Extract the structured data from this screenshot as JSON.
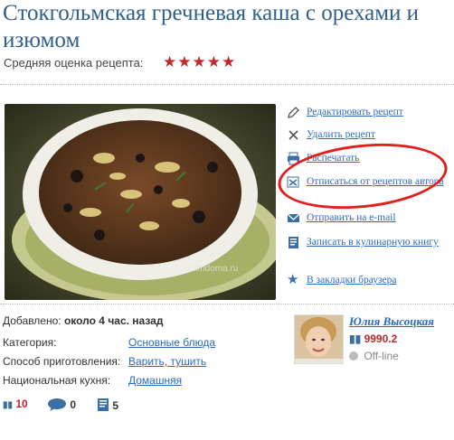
{
  "recipe": {
    "title": "Стокгольмская гречневая каша с орехами и изюмом",
    "rating_label": "Средняя оценка рецепта:",
    "stars": "★★★★★",
    "photo_watermark": "edimdoma.ru"
  },
  "actions": [
    {
      "label": "Редактировать рецепт",
      "icon": "pencil-icon"
    },
    {
      "label": "Удалить рецепт",
      "icon": "close-icon"
    },
    {
      "label": "Распечатать",
      "icon": "printer-icon"
    },
    {
      "label": "Отписаться от рецептов автора",
      "icon": "unsubscribe-icon"
    },
    {
      "label": "Отправить на e-mail",
      "icon": "envelope-icon"
    },
    {
      "label": "Записать в кулинарную книгу",
      "icon": "cookbook-icon"
    },
    {
      "label": "В закладки браузера",
      "icon": "star-icon"
    }
  ],
  "details": {
    "added_label": "Добавлено:",
    "added_value": "около 4 час. назад",
    "category_label": "Категория:",
    "category_value": "Основные блюда",
    "method_label": "Способ приготовления:",
    "method_value": "Варить, тушить",
    "cuisine_label": "Национальная кухня:",
    "cuisine_value": "Домашняя"
  },
  "author": {
    "name": "Юлия Высоцкая",
    "score": "9990.2",
    "status": "Off-line"
  },
  "stats": {
    "rating": "10",
    "comments": "0",
    "books": "5"
  },
  "colors": {
    "link": "#2a6bbf",
    "title": "#2d5f8a",
    "star": "#c0272d",
    "highlight_oval": "#e41d1d"
  }
}
